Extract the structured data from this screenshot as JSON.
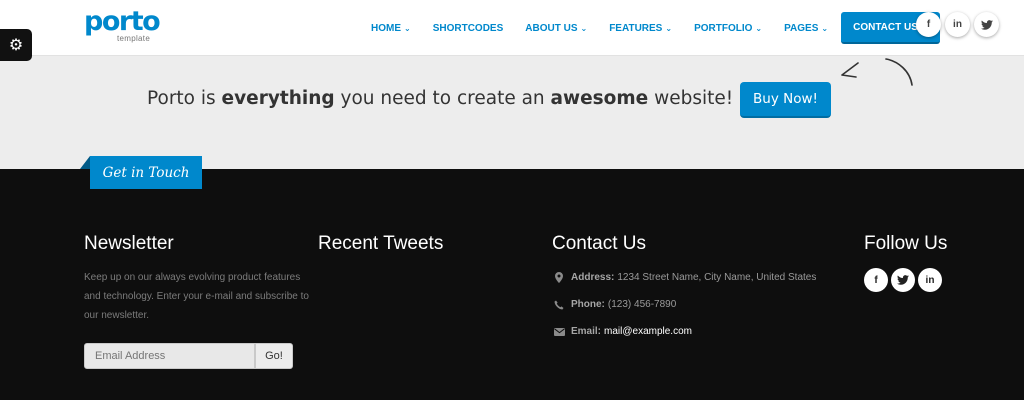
{
  "header": {
    "logo": {
      "name": "porto",
      "tagline": "template"
    },
    "nav": [
      {
        "label": "HOME",
        "has_dropdown": true
      },
      {
        "label": "SHORTCODES",
        "has_dropdown": false
      },
      {
        "label": "ABOUT US",
        "has_dropdown": true
      },
      {
        "label": "FEATURES",
        "has_dropdown": true
      },
      {
        "label": "PORTFOLIO",
        "has_dropdown": true
      },
      {
        "label": "PAGES",
        "has_dropdown": true
      },
      {
        "label": "CONTACT US",
        "has_dropdown": true,
        "active": true
      }
    ],
    "chevron": "⌄",
    "social": [
      {
        "icon": "facebook-icon",
        "glyph": "f"
      },
      {
        "icon": "linkedin-icon",
        "glyph": "in"
      },
      {
        "icon": "twitter-icon",
        "glyph": "🐦"
      }
    ]
  },
  "config_tab": {
    "icon": "gears-icon",
    "glyph": "⚙"
  },
  "cta": {
    "text_1": "Porto is ",
    "text_bold_1": "everything",
    "text_2": " you need to create an ",
    "text_bold_2": "awesome",
    "text_3": " website!",
    "button_label": "Buy Now!"
  },
  "footer": {
    "ribbon": "Get in Touch",
    "newsletter": {
      "title": "Newsletter",
      "text": "Keep up on our always evolving product features and technology. Enter your e-mail and subscribe to our newsletter.",
      "input_placeholder": "Email Address",
      "button_label": "Go!"
    },
    "tweets": {
      "title": "Recent Tweets"
    },
    "contact": {
      "title": "Contact Us",
      "address_label": "Address:",
      "address_value": "1234 Street Name, City Name, United States",
      "phone_label": "Phone:",
      "phone_value": "(123) 456-7890",
      "email_label": "Email:",
      "email_value": "mail@example.com"
    },
    "follow": {
      "title": "Follow Us",
      "items": [
        {
          "icon": "facebook-icon",
          "glyph": "f"
        },
        {
          "icon": "twitter-icon",
          "glyph": "🐦"
        },
        {
          "icon": "linkedin-icon",
          "glyph": "in"
        }
      ]
    }
  },
  "colors": {
    "primary": "#0088cc",
    "footer_bg": "#0e0e0e",
    "band_bg": "#ededed"
  }
}
